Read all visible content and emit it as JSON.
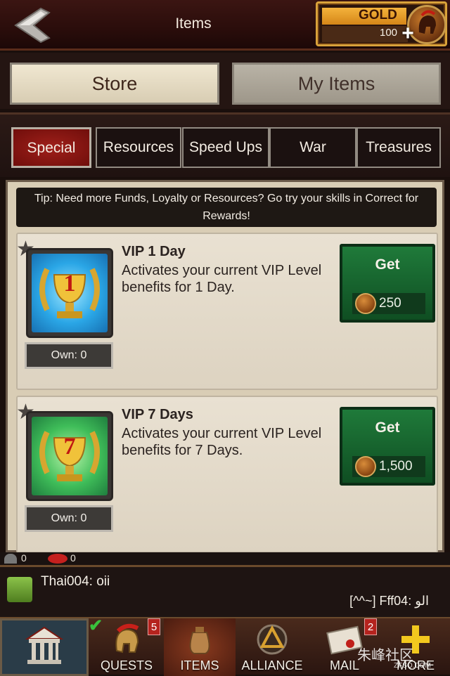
{
  "header": {
    "title": "Items",
    "gold_label": "GOLD",
    "gold_amount": "100"
  },
  "main_tabs": [
    {
      "label": "Store",
      "selected": true
    },
    {
      "label": "My Items",
      "selected": false
    }
  ],
  "sub_tabs": [
    {
      "label": "Special",
      "selected": true
    },
    {
      "label": "Resources"
    },
    {
      "label": "Speed Ups"
    },
    {
      "label": "War"
    },
    {
      "label": "Treasures"
    }
  ],
  "tip": "Tip: Need more Funds, Loyalty or Resources? Go try your skills in Correct for Rewards!",
  "items": [
    {
      "name": "VIP 1 Day",
      "description": "Activates your current VIP Level benefits for 1 Day.",
      "own": "Own: 0",
      "button": "Get",
      "price": "250",
      "icon_number": "1",
      "icon": "gold-trophy-icon"
    },
    {
      "name": "VIP 7 Days",
      "description": "Activates your current VIP Level benefits for 7 Days.",
      "own": "Own: 0",
      "button": "Get",
      "price": "1,500",
      "icon_number": "7",
      "icon": "gold-trophy-icon"
    }
  ],
  "chat": {
    "online_count": "0",
    "messages_count": "0",
    "line1": "Thai004: oii",
    "line2": "[^^~] Fff04: الو"
  },
  "nav": [
    {
      "label": "",
      "icon": "bank-icon"
    },
    {
      "label": "QUESTS",
      "badge": "5"
    },
    {
      "label": "ITEMS",
      "active": true
    },
    {
      "label": "ALLIANCE"
    },
    {
      "label": "MAIL",
      "badge": "2"
    },
    {
      "label": "MORE"
    }
  ],
  "watermark": {
    "text": "朱峰社区",
    "sub": "ZFSQ.COM"
  }
}
